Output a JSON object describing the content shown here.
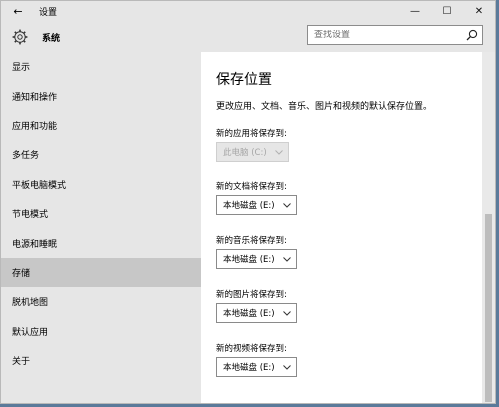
{
  "window": {
    "title": "设置",
    "back_glyph": "←",
    "minimize_glyph": "—",
    "maximize_glyph": "☐",
    "close_glyph": "✕"
  },
  "header": {
    "section_title": "系统",
    "search_placeholder": "查找设置"
  },
  "sidebar": {
    "items": [
      {
        "label": "显示"
      },
      {
        "label": "通知和操作"
      },
      {
        "label": "应用和功能"
      },
      {
        "label": "多任务"
      },
      {
        "label": "平板电脑模式"
      },
      {
        "label": "节电模式"
      },
      {
        "label": "电源和睡眠"
      },
      {
        "label": "存储",
        "active": true
      },
      {
        "label": "脱机地图"
      },
      {
        "label": "默认应用"
      },
      {
        "label": "关于"
      }
    ]
  },
  "content": {
    "title": "保存位置",
    "description": "更改应用、文档、音乐、图片和视频的默认保存位置。",
    "fields": [
      {
        "label": "新的应用将保存到:",
        "value": "此电脑 (C:)",
        "disabled": true
      },
      {
        "label": "新的文档将保存到:",
        "value": "本地磁盘 (E:)",
        "disabled": false
      },
      {
        "label": "新的音乐将保存到:",
        "value": "本地磁盘 (E:)",
        "disabled": false
      },
      {
        "label": "新的图片将保存到:",
        "value": "本地磁盘 (E:)",
        "disabled": false
      },
      {
        "label": "新的视频将保存到:",
        "value": "本地磁盘 (E:)",
        "disabled": false
      }
    ]
  },
  "colors": {
    "sidebar_bg": "#e6e6e6",
    "active_item_bg": "#c7c7c7",
    "content_bg": "#ffffff"
  }
}
